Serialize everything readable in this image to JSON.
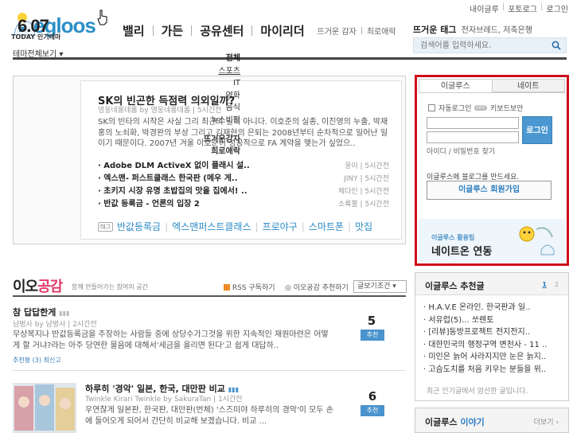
{
  "header": {
    "top_links": [
      "내이글루",
      "포토로그",
      "로그인"
    ],
    "logo_text": "egloos",
    "nav": [
      "밸리",
      "가든",
      "공유센터",
      "마이리더"
    ],
    "nav_small": [
      "뜨거운 감자",
      "최로애락"
    ],
    "theme_select": "테마전체보기",
    "hot_tags_label": "뜨거운 태그",
    "hot_tags": "전자브레드, 저축은행",
    "search_placeholder": "검색어를 입력하세요."
  },
  "today": {
    "date": "6.07",
    "label": "TODAY 인기테마",
    "categories": [
      "전체",
      "스포츠",
      "IT",
      "영화",
      "음식",
      "뉴스비평"
    ],
    "extra": [
      "뜨거운감자",
      "희로애락"
    ],
    "featured_title": "SK의 빈곤한 득점력 의외일까?",
    "featured_meta": "영웅네롱데롬 by 영웅네롱데롬 | 5시간전",
    "featured_body": "SK의 빈타의 시작은 사실 그리 최근의 일이 아니다. 이호준의 실종, 이진영의 누출, 박재홍의 노쇠화, 박경완의 부상 그리고 김재현의 은퇴는 2008년부터 순차적으로 일어난 일이기 때문이다. 2007년 겨울 이호준이 성공적으로 FA 계약을 맺는가 싶었으..",
    "posts": [
      {
        "title": "Adobe DLM ActiveX 없이 플래시 설..",
        "author": "웅이",
        "time": "5시간전"
      },
      {
        "title": "엑스맨- 퍼스트클래스 한국판 (메우 게..",
        "author": "JINY",
        "time": "5시간전"
      },
      {
        "title": "초키지 시장 유명 초밥집의 맛을 집에서! ..",
        "author": "체다인",
        "time": "5시간전"
      },
      {
        "title": "반값 등록금 - 언론의 입장 2",
        "author": "소록불",
        "time": "5시간전"
      }
    ],
    "tag_badge": "태그",
    "tags": [
      "반값등록금",
      "엑스맨퍼스트클래스",
      "프로야구",
      "스마트폰",
      "맛집"
    ]
  },
  "login": {
    "tab_egloos": "이글루스",
    "tab_nate": "네이트",
    "auto_login": "자동로그인",
    "off_label": "OFF",
    "keyboard_security": "키보드보안",
    "login_button": "로그인",
    "find_link": "아이디 / 비밀번호 찾기",
    "make_blog": "이글루스에 블로그를 만드세요.",
    "join_button": "이글루스 회원가입",
    "banner_sub": "이글루스 활용팁",
    "banner_main": "네이트온 연동"
  },
  "io": {
    "title_a": "이오",
    "title_b": "공감",
    "subtitle": "함께 만들어가는 참여의 공간",
    "rss": "RSS 구독하기",
    "recommend": "이오공감 추천하기",
    "sort": "글보기조건",
    "entries": [
      {
        "title": "참 답답한게",
        "meta": "남벙사 by 남벙사 | 2시간전",
        "body": "무상복지나 반값등록금을 주장하는 사람들 중에 상당수가그것을 위한 지속적인 재원마련은 어떻게 할 거냐?라는 아주 당연한 물음에 대해서'세금을 올리면 된다'고 쉽게 대답하..",
        "footer": "추천평 (3)   최신고",
        "count": "5",
        "button": "추천"
      },
      {
        "title": "하루히 '경악' 일본, 한국, 대만판 비교",
        "meta": "Twinkle Kirari Twinkle by SakuraTan | 1시간전",
        "body": "우연찮게 일본판, 한국판, 대만판(번체) '스즈미야 하루히의 경악'이 모두 손에 들어오게 되어서 간단히 비교해 보겠습니다. 비교 ...",
        "count": "6",
        "button": "추천"
      }
    ]
  },
  "recommend_box": {
    "title": "이글루스 추천글",
    "pages": [
      "1",
      "2"
    ],
    "items": [
      "H.A.V.E 온라인. 한국판과 일..",
      "서유럽(5)... 쏘렌토",
      "[리뷰]동방프로젝트 전지전지..",
      "대한민국의 행정구역 변천사 - 11 ..",
      "미인은 늙어 사라지지만 눈은 늙지..",
      "고슴도치를 처음 키우는 분들을 위.."
    ],
    "footer": "최근 인기글에서 엄선한 글입니다."
  },
  "story": {
    "title_a": "이글루스",
    "title_b": "이야기",
    "more": "더보기"
  }
}
